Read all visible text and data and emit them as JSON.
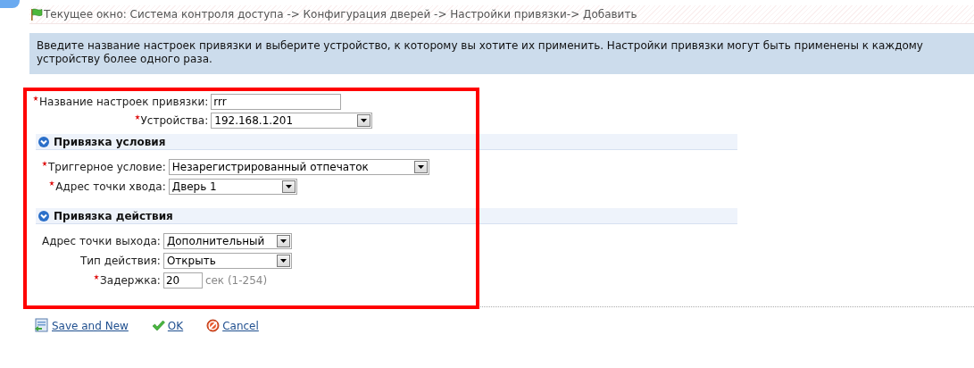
{
  "breadcrumb": "Текущее окно: Система контроля доступа -> Конфигурация дверей -> Настройки привязки-> Добавить",
  "info": "Введите название настроек привязки и выберите устройство, к которому вы хотите их применить. Настройки привязки могут быть применены к каждому устройству более одного раза.",
  "fields": [
    {
      "kind": "input",
      "label": "Название настроек привязки:",
      "required": true,
      "value": "rrr"
    },
    {
      "kind": "select",
      "label": "Устройства:",
      "required": true,
      "value": "192.168.1.201"
    }
  ],
  "sections": [
    {
      "title": "Привязка условия",
      "expanded": true,
      "fields": [
        {
          "kind": "select",
          "label": "Триггерное условие:",
          "required": true,
          "value": "Незарегистрированный отпечаток"
        },
        {
          "kind": "select",
          "label": "Адрес точки хвода:",
          "required": true,
          "value": "Дверь 1"
        }
      ]
    },
    {
      "title": "Привязка действия",
      "expanded": true,
      "fields": [
        {
          "kind": "select",
          "label": "Адрес точки выхода:",
          "required": false,
          "value": "Дополнительный"
        },
        {
          "kind": "select",
          "label": "Тип действия:",
          "required": false,
          "value": "Открыть"
        },
        {
          "kind": "input",
          "label": "Задержка:",
          "required": true,
          "value": "20",
          "unit": "сек (1-254)"
        }
      ]
    }
  ],
  "buttons": [
    {
      "kind": "save-new",
      "label": "Save and New"
    },
    {
      "kind": "ok",
      "label": "OK"
    },
    {
      "kind": "cancel",
      "label": "Cancel"
    }
  ]
}
